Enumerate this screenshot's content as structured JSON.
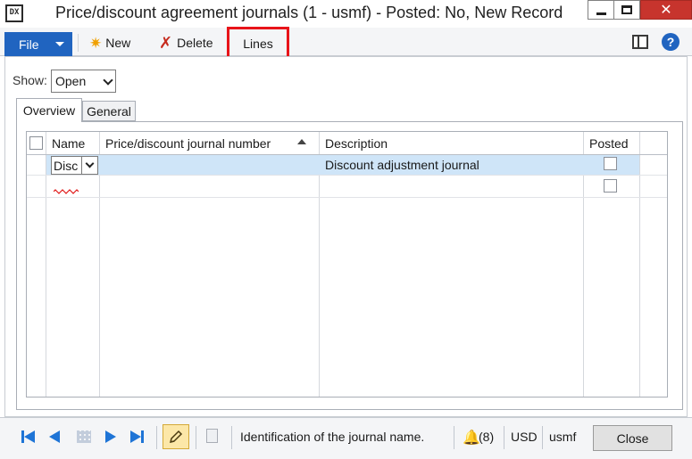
{
  "window": {
    "title": "Price/discount agreement journals (1 - usmf) - Posted: No, New Record",
    "app_icon_text": "DX",
    "close_glyph": "✕"
  },
  "ribbon": {
    "file_label": "File",
    "new_label": "New",
    "delete_label": "Delete",
    "lines_label": "Lines",
    "help_glyph": "?",
    "highlight_color": "#e8141a"
  },
  "filter": {
    "show_label": "Show:",
    "show_value": "Open"
  },
  "tabs": [
    {
      "label": "Overview",
      "active": true
    },
    {
      "label": "General",
      "active": false
    }
  ],
  "grid": {
    "columns": [
      "Name",
      "Price/discount journal number",
      "Description",
      "Posted"
    ],
    "rows": [
      {
        "name": "Disc",
        "journal_number": "",
        "description": "Discount adjustment journal",
        "posted": false
      },
      {
        "name": "",
        "journal_number": "",
        "description": "",
        "posted": false
      }
    ]
  },
  "statusbar": {
    "help_text": "Identification of the journal name.",
    "notifications": "(8)",
    "currency": "USD",
    "company": "usmf",
    "close_label": "Close"
  },
  "colors": {
    "accent": "#2064c0",
    "selected_row": "#cfe5f8",
    "nav_blue": "#1e74d6"
  }
}
